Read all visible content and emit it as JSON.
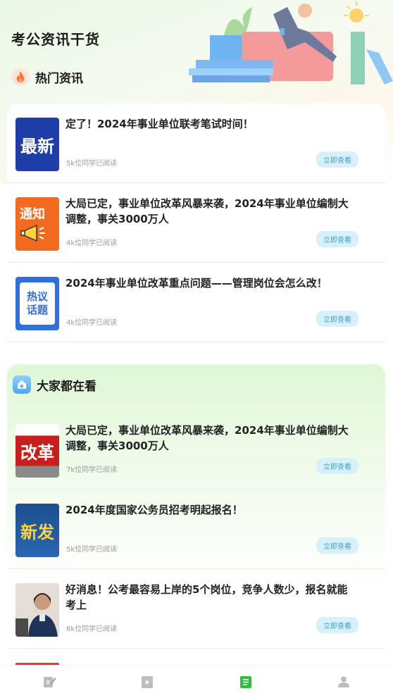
{
  "header": {
    "title": "考公资讯干货"
  },
  "hot_section": {
    "title": "热门资讯",
    "icon": "fire-icon",
    "items": [
      {
        "thumb_text": "最新",
        "thumb_color": "#1f3da6",
        "title": "定了！2024年事业单位联考笔试时间！",
        "reads": "5k位同学已阅读",
        "action": "立即查看"
      },
      {
        "thumb_text": "通知",
        "thumb_color": "#f26b21",
        "title": "大局已定，事业单位改革风暴来袭，2024年事业单位编制大调整，事关3000万人",
        "reads": "4k位同学已阅读",
        "action": "立即查看"
      },
      {
        "thumb_text": "热议话题",
        "thumb_color": "#2f6fe0",
        "title": "2024年事业单位改革重点问题——管理岗位会怎么改！",
        "reads": "4k位同学已阅读",
        "action": "立即查看"
      }
    ]
  },
  "watch_section": {
    "title": "大家都在看",
    "icon": "house-icon",
    "items": [
      {
        "thumb_text": "改革",
        "thumb_color": "#c81e1e",
        "title": "大局已定，事业单位改革风暴来袭，2024年事业单位编制大调整，事关3000万人",
        "reads": "7k位同学已阅读",
        "action": "立即查看"
      },
      {
        "thumb_text": "新发",
        "thumb_color": "#1d4f8f",
        "title": "2024年度国家公务员招考明起报名！",
        "reads": "5k位同学已阅读",
        "action": "立即查看"
      },
      {
        "thumb_text": "",
        "thumb_color": "#d9d2cc",
        "title": "好消息！公考最容易上岸的5个岗位，竞争人数少，报名就能考上",
        "reads": "8k位同学已阅读",
        "action": "立即查看"
      }
    ]
  },
  "tabbar": {
    "tabs": [
      {
        "icon": "edit-icon",
        "active": false
      },
      {
        "icon": "video-icon",
        "active": false
      },
      {
        "icon": "article-icon",
        "active": true
      },
      {
        "icon": "user-icon",
        "active": false
      }
    ],
    "active_color": "#2fbf3a",
    "inactive_color": "#b5b5b5"
  }
}
